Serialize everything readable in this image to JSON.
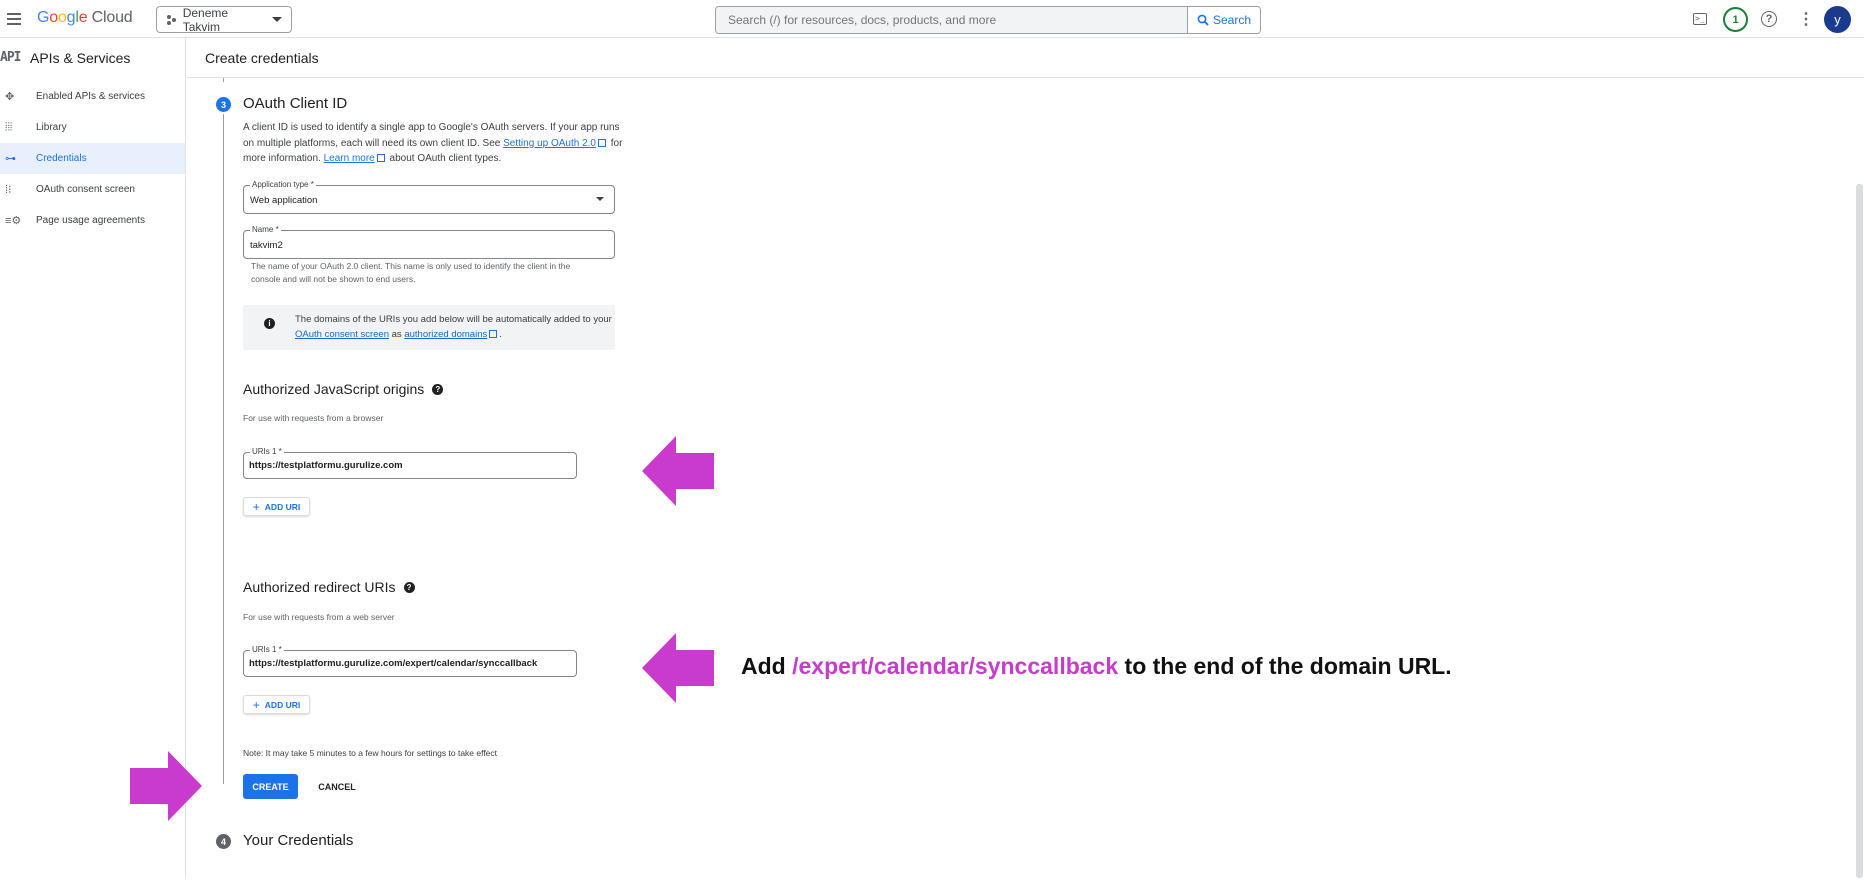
{
  "colors": {
    "accent": "#c93bcc",
    "primary": "#1a73e8"
  },
  "topbar": {
    "logo_parts": [
      "G",
      "o",
      "o",
      "g",
      "l",
      "e"
    ],
    "logo_cloud": "Cloud",
    "project_name": "Deneme Takvim",
    "search_placeholder": "Search (/) for resources, docs, products, and more",
    "search_button": "Search",
    "notification_count": "1",
    "avatar_initial": "y",
    "icons": [
      "menu-icon",
      "terminal-icon",
      "help-icon",
      "more-vert-icon",
      "search-icon"
    ]
  },
  "sidebar": {
    "logo": "API",
    "title": "APIs & Services",
    "items": [
      {
        "label": "Enabled APIs & services",
        "icon": "api-hub-icon"
      },
      {
        "label": "Library",
        "icon": "library-icon"
      },
      {
        "label": "Credentials",
        "icon": "key-icon",
        "active": true
      },
      {
        "label": "OAuth consent screen",
        "icon": "consent-icon"
      },
      {
        "label": "Page usage agreements",
        "icon": "settings-list-icon"
      }
    ]
  },
  "page": {
    "title": "Create credentials"
  },
  "step3": {
    "number": "3",
    "title": "OAuth Client ID",
    "desc_1": "A client ID is used to identify a single app to Google's OAuth servers. If your app runs on multiple platforms, each will need its own client ID. See",
    "desc_link1": "Setting up OAuth 2.0",
    "desc_2": "for more information.",
    "desc_link2": "Learn more",
    "desc_3": "about OAuth client types."
  },
  "app_type": {
    "label": "Application type *",
    "value": "Web application"
  },
  "name_field": {
    "label": "Name *",
    "value": "takvim2",
    "hint": "The name of your OAuth 2.0 client. This name is only used to identify the client in the console and will not be shown to end users."
  },
  "info": {
    "text_1": "The domains of the URIs you add below will be automatically added to your",
    "link1": "OAuth consent screen",
    "text_2": "as",
    "link2": "authorized domains",
    "text_3": "."
  },
  "js_origins": {
    "title": "Authorized JavaScript origins",
    "subtitle": "For use with requests from a browser",
    "uri_label": "URIs 1 *",
    "uri_value": "https://testplatformu.gurulize.com",
    "add_label": "ADD URI"
  },
  "redirect_uris": {
    "title": "Authorized redirect URIs",
    "subtitle": "For use with requests from a web server",
    "uri_label": "URIs 1 *",
    "uri_value": "https://testplatformu.gurulize.com/expert/calendar/synccallback",
    "add_label": "ADD URI"
  },
  "footer": {
    "note": "Note: It may take 5 minutes to a few hours for settings to take effect",
    "create": "CREATE",
    "cancel": "CANCEL"
  },
  "step4": {
    "number": "4",
    "title": "Your Credentials"
  },
  "annotation": {
    "prefix": "Add",
    "highlight": "/expert/calendar/synccallback",
    "suffix": "to the end of the domain URL."
  }
}
